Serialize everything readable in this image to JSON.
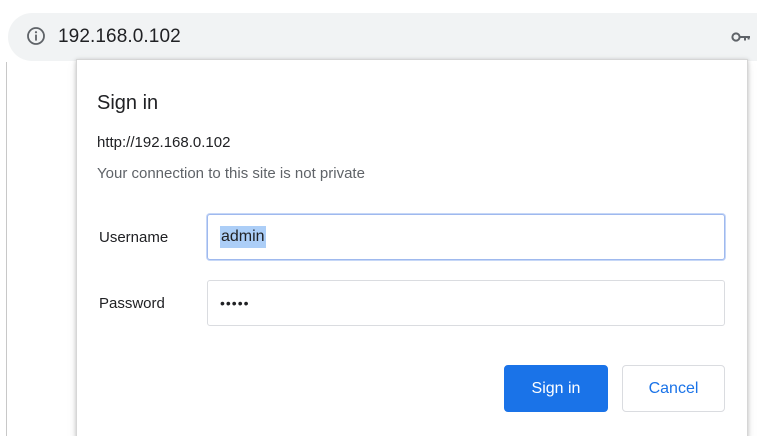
{
  "address_bar": {
    "url": "192.168.0.102",
    "info_icon": "info-icon",
    "key_icon": "key-icon"
  },
  "dialog": {
    "title": "Sign in",
    "origin": "http://192.168.0.102",
    "warning": "Your connection to this site is not private",
    "username": {
      "label": "Username",
      "value": "admin"
    },
    "password": {
      "label": "Password",
      "value": "•••••"
    },
    "buttons": {
      "sign_in": "Sign in",
      "cancel": "Cancel"
    }
  },
  "colors": {
    "accent": "#1a73e8",
    "selection": "#accef7",
    "address_bar_bg": "#f1f3f4"
  }
}
